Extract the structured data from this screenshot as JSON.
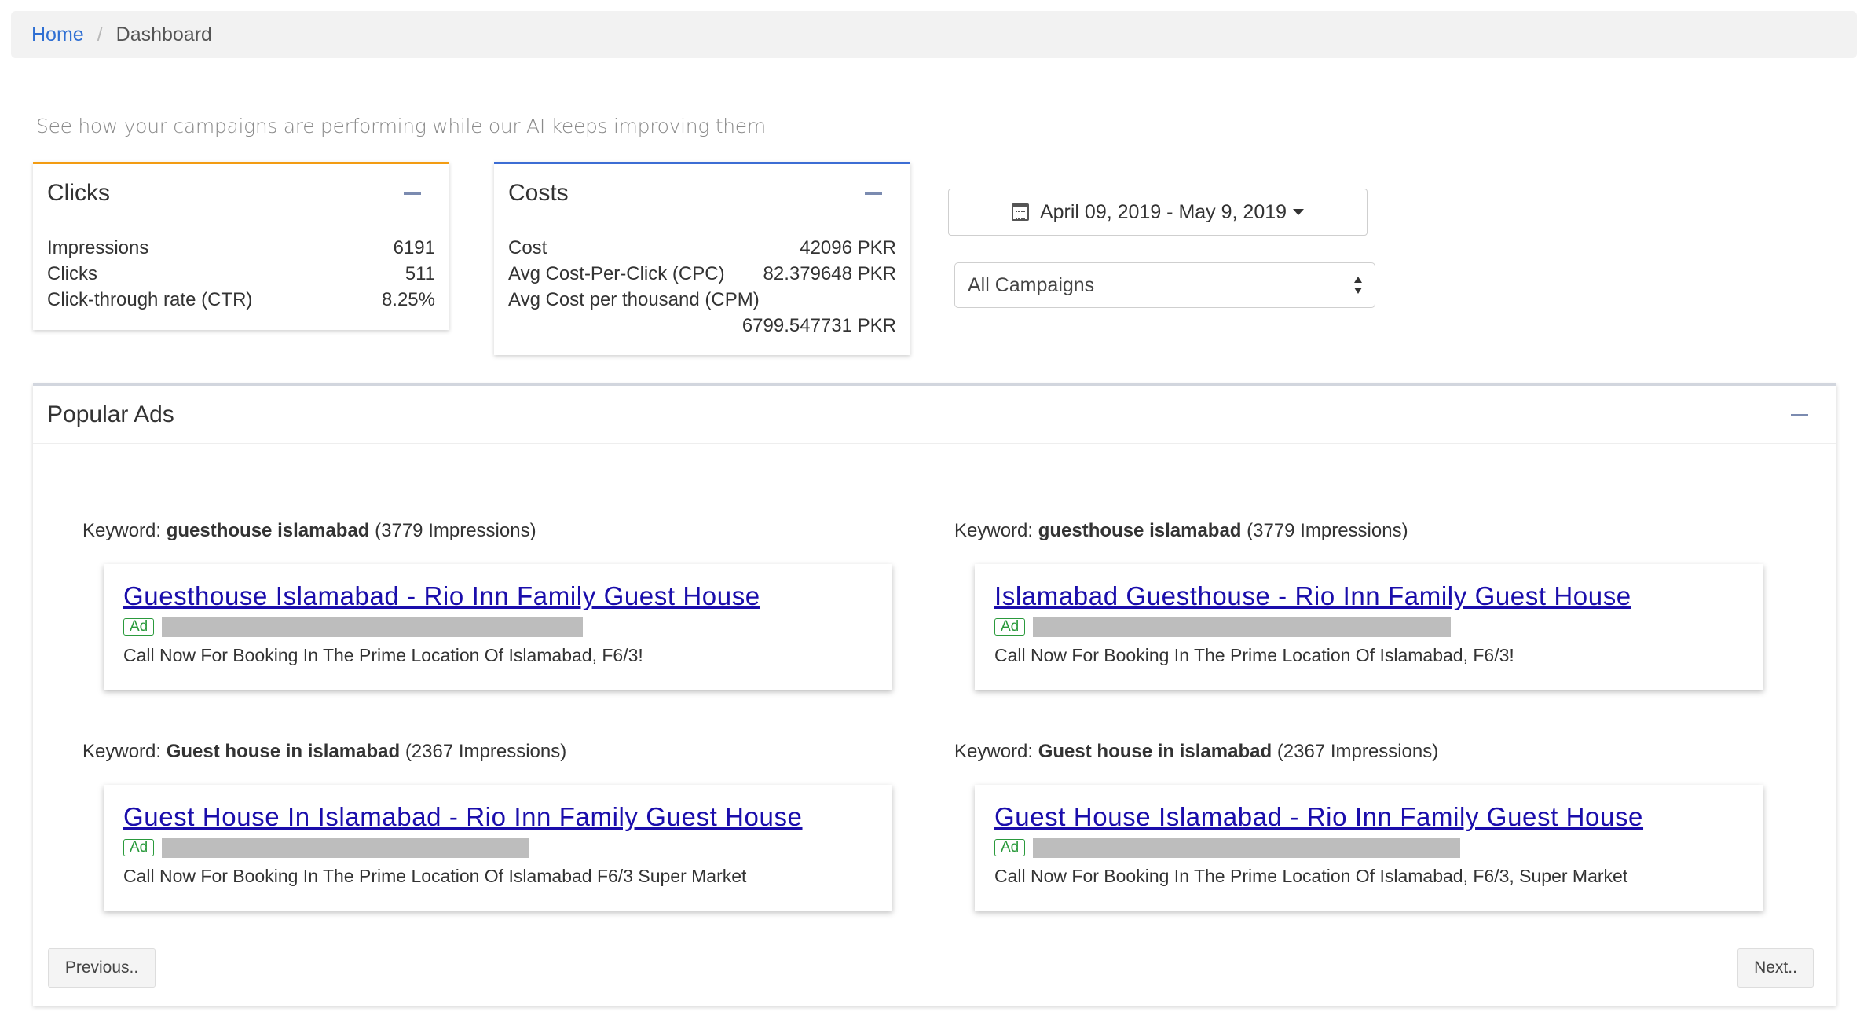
{
  "breadcrumb": {
    "home": "Home",
    "current": "Dashboard"
  },
  "subtitle": "See how your campaigns are performing while our AI keeps improving them",
  "clicks": {
    "title": "Clicks",
    "rows": [
      {
        "label": "Impressions",
        "value": "6191"
      },
      {
        "label": "Clicks",
        "value": "511"
      },
      {
        "label": "Click-through rate (CTR)",
        "value": "8.25%"
      }
    ]
  },
  "costs": {
    "title": "Costs",
    "rows": [
      {
        "label": "Cost",
        "value": "42096 PKR"
      },
      {
        "label": "Avg Cost-Per-Click (CPC)",
        "value": "82.379648 PKR"
      },
      {
        "label": "Avg Cost per thousand (CPM)",
        "value": "6799.547731 PKR"
      }
    ]
  },
  "date_range": {
    "label": "April 09, 2019 - May 9, 2019",
    "icon": "calendar-icon"
  },
  "campaign_select": {
    "selected": "All Campaigns"
  },
  "popular_ads": {
    "title": "Popular Ads",
    "keyword_prefix": "Keyword:",
    "ads": [
      {
        "keyword": "guesthouse islamabad",
        "impressions": "(3779 Impressions)",
        "title": "Guesthouse Islamabad - Rio Inn Family Guest House",
        "badge": "Ad",
        "description": "Call Now For Booking In The Prime Location Of Islamabad, F6/3!"
      },
      {
        "keyword": "guesthouse islamabad",
        "impressions": "(3779 Impressions)",
        "title": "Islamabad Guesthouse - Rio Inn Family Guest House",
        "badge": "Ad",
        "description": "Call Now For Booking In The Prime Location Of Islamabad, F6/3!"
      },
      {
        "keyword": "Guest house in islamabad",
        "impressions": "(2367 Impressions)",
        "title": "Guest House In Islamabad - Rio Inn Family Guest House",
        "badge": "Ad",
        "description": "Call Now For Booking In The Prime Location Of Islamabad F6/3 Super Market"
      },
      {
        "keyword": "Guest house in islamabad",
        "impressions": "(2367 Impressions)",
        "title": "Guest House Islamabad - Rio Inn Family Guest House",
        "badge": "Ad",
        "description": "Call Now For Booking In The Prime Location Of Islamabad, F6/3, Super Market"
      }
    ],
    "previous_label": "Previous..",
    "next_label": "Next.."
  }
}
